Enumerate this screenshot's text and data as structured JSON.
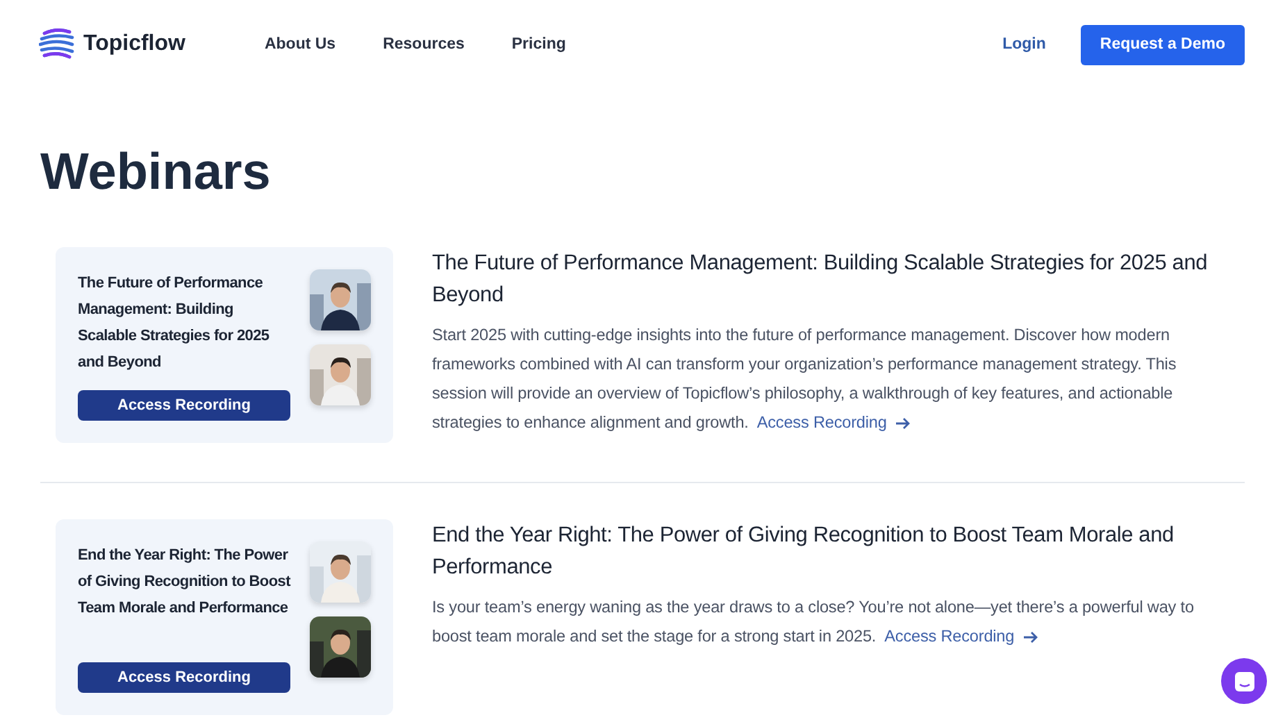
{
  "header": {
    "brand": "Topicflow",
    "nav": [
      "About Us",
      "Resources",
      "Pricing"
    ],
    "login": "Login",
    "cta": "Request a Demo"
  },
  "page_title": "Webinars",
  "webinars": [
    {
      "card_title": "The Future of Performance Management: Building Scalable Strategies for 2025 and Beyond",
      "card_button": "Access Recording",
      "title": "The Future of Performance Management: Building Scalable Strategies for 2025 and Beyond",
      "description": "Start 2025 with cutting-edge insights into the future of performance management. Discover how modern frameworks combined with AI can transform your organization’s performance management strategy. This session will provide an overview of Topicflow’s philosophy, a walkthrough of key features, and actionable strategies to enhance alignment and growth.",
      "link": "Access Recording"
    },
    {
      "card_title": "End the Year Right: The Power of Giving Recognition to Boost Team Morale and Performance",
      "card_button": "Access Recording",
      "title": "End the Year Right: The Power of Giving Recognition to Boost Team Morale and Performance",
      "description": "Is your team’s energy waning as the year draws to a close? You’re not alone—yet there’s a powerful way to boost team morale and set the stage for a strong start in 2025.",
      "link": "Access Recording"
    }
  ]
}
